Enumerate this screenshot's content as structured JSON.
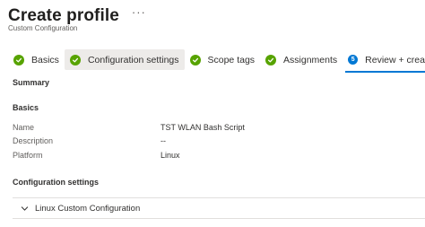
{
  "header": {
    "title": "Create profile",
    "more": "···",
    "subtitle": "Custom Configuration"
  },
  "steps": [
    {
      "label": "Basics",
      "status": "complete"
    },
    {
      "label": "Configuration settings",
      "status": "complete"
    },
    {
      "label": "Scope tags",
      "status": "complete"
    },
    {
      "label": "Assignments",
      "status": "complete"
    },
    {
      "label": "Review + create",
      "status": "current",
      "number": "5"
    }
  ],
  "summary": {
    "heading": "Summary",
    "basics_heading": "Basics",
    "basics": [
      {
        "key": "Name",
        "value": "TST WLAN Bash Script"
      },
      {
        "key": "Description",
        "value": "--"
      },
      {
        "key": "Platform",
        "value": "Linux"
      }
    ],
    "config_heading": "Configuration settings",
    "config_item": "Linux Custom Configuration"
  },
  "colors": {
    "complete": "#57a300",
    "accent": "#0078d4"
  }
}
